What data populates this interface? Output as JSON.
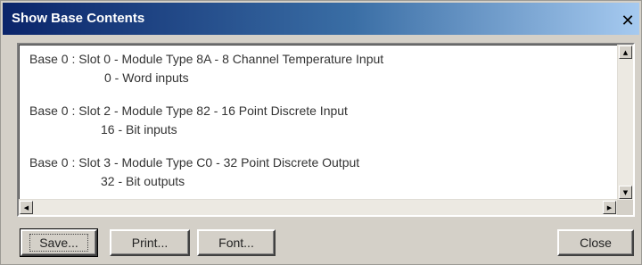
{
  "window": {
    "title": "Show Base Contents",
    "close_glyph": "✕",
    "close_icon": "close-icon"
  },
  "contents": {
    "entries": [
      {
        "line1": "Base 0 : Slot 0 - Module Type 8A - 8 Channel Temperature Input",
        "line2": "0 - Word inputs"
      },
      {
        "line1": "Base 0 : Slot 2 - Module Type 82 - 16 Point Discrete Input",
        "line2": "16 - Bit inputs"
      },
      {
        "line1": "Base 0 : Slot 3 - Module Type C0 - 32 Point Discrete Output",
        "line2": "32 - Bit outputs"
      }
    ]
  },
  "scrollbars": {
    "up_glyph": "▲",
    "down_glyph": "▼",
    "left_glyph": "◀",
    "right_glyph": "▶"
  },
  "buttons": {
    "save": "Save...",
    "print": "Print...",
    "font": "Font...",
    "close": "Close"
  },
  "colors": {
    "titlebar_start": "#0a246a",
    "titlebar_end": "#a6caf0",
    "dialog_face": "#d4d0c8"
  }
}
